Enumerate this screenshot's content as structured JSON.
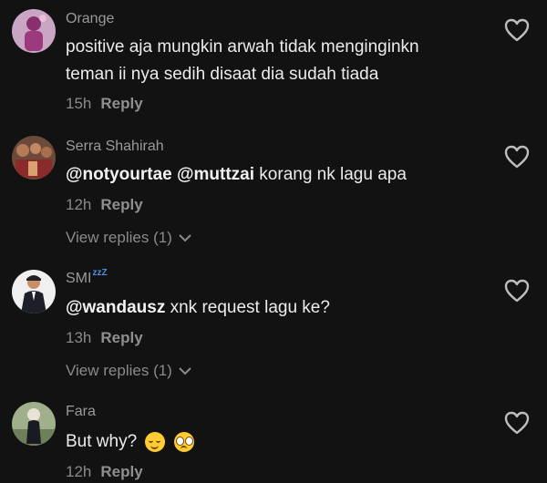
{
  "colors": {
    "background": "#121212",
    "username": "#9a9a9a",
    "text": "#ececec",
    "meta": "#8a8a8a",
    "badge": "#4a90e2"
  },
  "comments": [
    {
      "username": "Orange",
      "text_line1": "positive aja mungkin arwah tidak menginginkn",
      "text_line2": "teman ii nya sedih disaat dia sudah tiada",
      "time": "15h",
      "reply_label": "Reply",
      "heart_icon": "heart-outline-icon"
    },
    {
      "username": "Serra Shahirah",
      "mention1": "@notyourtae",
      "mention2": "@muttzai",
      "text_rest": "korang nk lagu apa",
      "time": "12h",
      "reply_label": "Reply",
      "view_replies": "View replies (1)",
      "heart_icon": "heart-outline-icon"
    },
    {
      "username": "SMI",
      "badge": "zzZ",
      "mention": "@wandausz",
      "text_rest": "xnk request lagu ke?",
      "time": "13h",
      "reply_label": "Reply",
      "view_replies": "View replies (1)",
      "heart_icon": "heart-outline-icon"
    },
    {
      "username": "Fara",
      "text": "But why?",
      "emojis": [
        "relieved-face-emoji",
        "pleading-face-emoji"
      ],
      "time": "12h",
      "reply_label": "Reply",
      "heart_icon": "heart-outline-icon"
    }
  ]
}
